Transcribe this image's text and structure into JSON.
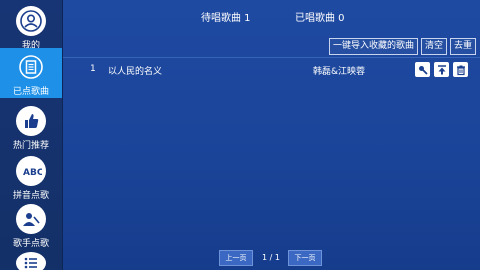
{
  "sidebar": {
    "items": [
      {
        "label": "我的",
        "icon": "user-icon"
      },
      {
        "label": "已点歌曲",
        "icon": "document-icon"
      },
      {
        "label": "热门推荐",
        "icon": "thumbs-up-icon"
      },
      {
        "label": "拼音点歌",
        "icon": "abc-icon"
      },
      {
        "label": "歌手点歌",
        "icon": "singer-icon"
      },
      {
        "label": "",
        "icon": "list-icon"
      }
    ]
  },
  "tabs": {
    "pending": "待唱歌曲 1",
    "sung": "已唱歌曲 0"
  },
  "toolbar": {
    "import": "一键导入收藏的歌曲",
    "clear": "清空",
    "dedupe": "去重"
  },
  "songs": [
    {
      "num": "1",
      "name": "以人民的名义",
      "artist": "韩磊&江映蓉"
    }
  ],
  "pager": {
    "prev": "上一页",
    "info": "1 / 1",
    "next": "下一页"
  }
}
